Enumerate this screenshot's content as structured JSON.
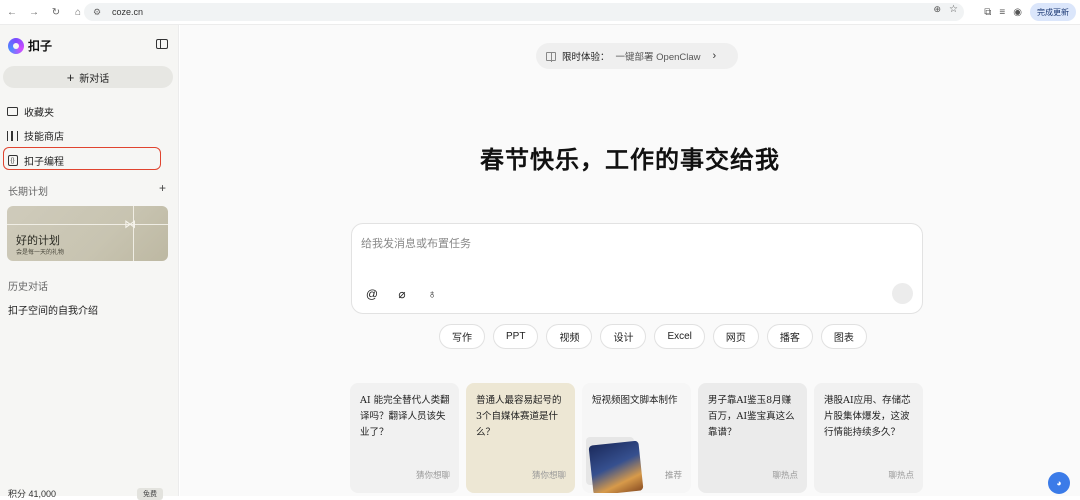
{
  "browser": {
    "url": "coze.cn",
    "update_label": "完成更新"
  },
  "sidebar": {
    "brand": "扣子",
    "new_chat_label": "新对话",
    "nav": [
      {
        "label": "收藏夹",
        "icon": "folder-icon"
      },
      {
        "label": "技能商店",
        "icon": "books-icon"
      },
      {
        "label": "扣子编程",
        "icon": "code-icon"
      }
    ],
    "long_term_title": "长期计划",
    "plan_card": {
      "title": "好的计划",
      "subtitle": "会是每一天的礼物"
    },
    "history_title": "历史对话",
    "history": [
      {
        "label": "扣子空间的自我介绍"
      }
    ],
    "bottom_left": "积分 41,000",
    "bottom_badge": "免费"
  },
  "main": {
    "promo": {
      "prefix": "限时体验：",
      "text": "一键部署 OpenClaw"
    },
    "headline": "春节快乐，工作的事交给我",
    "composer": {
      "placeholder": "给我发消息或布置任务"
    },
    "chips": [
      "写作",
      "PPT",
      "视频",
      "设计",
      "Excel",
      "网页",
      "播客",
      "图表"
    ],
    "cards": [
      {
        "text": "AI 能完全替代人类翻译吗？翻译人员该失业了？",
        "tag": "猜你想聊"
      },
      {
        "text": "普通人最容易起号的3个自媒体赛道是什么？",
        "tag": "猜你想聊"
      },
      {
        "text": "短视频图文脚本制作",
        "tag": "推荐"
      },
      {
        "text": "男子靠AI鉴玉8月赚百万，AI鉴宝真这么靠谱？",
        "tag": "聊热点"
      },
      {
        "text": "港股AI应用、存储芯片股集体爆发，这波行情能持续多久？",
        "tag": "聊热点"
      }
    ]
  },
  "colors": {
    "highlight": "#e0442f",
    "accent_blue": "#3b7be8"
  }
}
